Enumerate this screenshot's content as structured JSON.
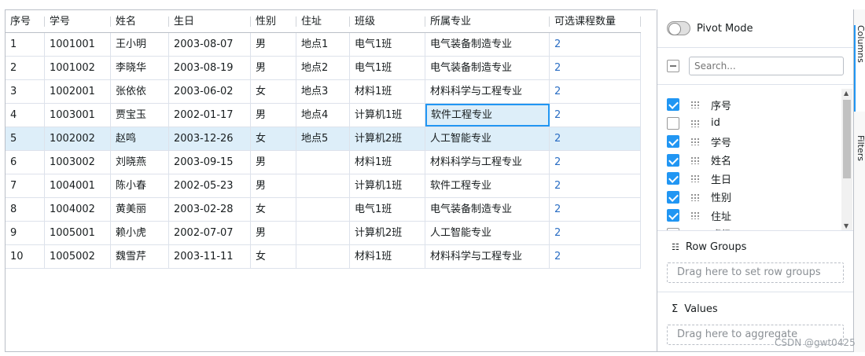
{
  "columns": [
    "序号",
    "学号",
    "姓名",
    "生日",
    "性别",
    "住址",
    "班级",
    "所属专业",
    "可选课程数量"
  ],
  "rows": [
    [
      "1",
      "1001001",
      "王小明",
      "2003-08-07",
      "男",
      "地点1",
      "电气1班",
      "电气装备制造专业",
      "2"
    ],
    [
      "2",
      "1001002",
      "李晓华",
      "2003-08-19",
      "男",
      "地点2",
      "电气1班",
      "电气装备制造专业",
      "2"
    ],
    [
      "3",
      "1002001",
      "张依依",
      "2003-06-02",
      "女",
      "地点3",
      "材料1班",
      "材料科学与工程专业",
      "2"
    ],
    [
      "4",
      "1003001",
      "贾宝玉",
      "2002-01-17",
      "男",
      "地点4",
      "计算机1班",
      "软件工程专业",
      "2"
    ],
    [
      "5",
      "1002002",
      "赵鸣",
      "2003-12-26",
      "女",
      "地点5",
      "计算机2班",
      "人工智能专业",
      "2"
    ],
    [
      "6",
      "1003002",
      "刘晓燕",
      "2003-09-15",
      "男",
      "",
      "材料1班",
      "材料科学与工程专业",
      "2"
    ],
    [
      "7",
      "1004001",
      "陈小春",
      "2002-05-23",
      "男",
      "",
      "计算机1班",
      "软件工程专业",
      "2"
    ],
    [
      "8",
      "1004002",
      "黄美丽",
      "2003-02-28",
      "女",
      "",
      "电气1班",
      "电气装备制造专业",
      "2"
    ],
    [
      "9",
      "1005001",
      "赖小虎",
      "2002-07-07",
      "男",
      "",
      "计算机2班",
      "人工智能专业",
      "2"
    ],
    [
      "10",
      "1005002",
      "魏雪芹",
      "2003-11-11",
      "女",
      "",
      "材料1班",
      "材料科学与工程专业",
      "2"
    ]
  ],
  "selected_row_index": 4,
  "focused_cell": {
    "row": 3,
    "col": 7
  },
  "tool_panel": {
    "pivot_mode_label": "Pivot Mode",
    "pivot_mode_on": false,
    "search_placeholder": "Search...",
    "column_list": [
      {
        "label": "序号",
        "checked": true
      },
      {
        "label": "id",
        "checked": false
      },
      {
        "label": "学号",
        "checked": true
      },
      {
        "label": "姓名",
        "checked": true
      },
      {
        "label": "生日",
        "checked": true
      },
      {
        "label": "性别",
        "checked": true
      },
      {
        "label": "住址",
        "checked": true
      },
      {
        "label": "班级id",
        "checked": false
      }
    ],
    "row_groups_label": "Row Groups",
    "row_groups_drop": "Drag here to set row groups",
    "values_label": "Values",
    "values_drop": "Drag here to aggregate"
  },
  "side_tabs": {
    "columns": "Columns",
    "filters": "Filters"
  },
  "watermark": "CSDN @gwt0425",
  "colors": {
    "accent": "#2196f3",
    "selected_row": "#ddeef9",
    "link": "#2b6ec4",
    "border": "#babfc7"
  }
}
